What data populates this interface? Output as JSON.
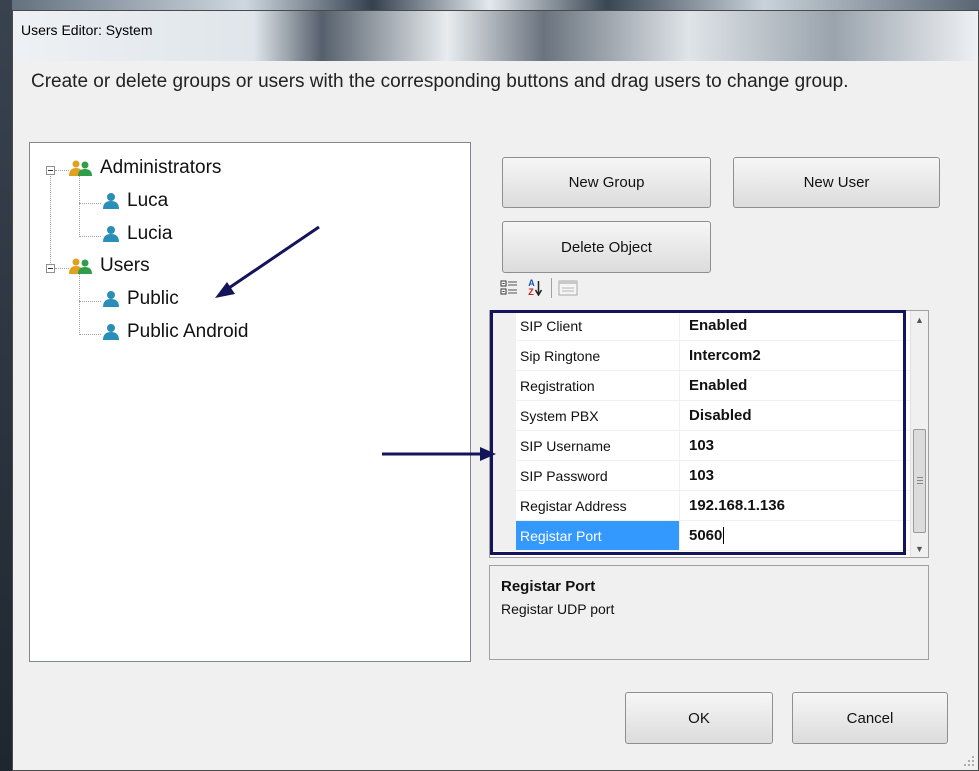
{
  "window": {
    "title": "Users Editor: System"
  },
  "instruction": "Create or delete groups or users with the corresponding buttons and drag users to change group.",
  "tree": {
    "groups": [
      {
        "label": "Administrators",
        "icon": "group-icon",
        "users": [
          "Luca",
          "Lucia"
        ]
      },
      {
        "label": "Users",
        "icon": "group-icon",
        "users": [
          "Public",
          "Public Android"
        ]
      }
    ]
  },
  "buttons": {
    "new_group": "New Group",
    "new_user": "New User",
    "delete_object": "Delete Object",
    "ok": "OK",
    "cancel": "Cancel"
  },
  "toolbar": {
    "icons": [
      "categorized-icon",
      "alphabetical-sort-icon",
      "property-pages-icon"
    ],
    "sort_glyph_top": "A",
    "sort_glyph_bottom": "Z"
  },
  "properties": [
    {
      "name": "SIP Client",
      "value": "Enabled"
    },
    {
      "name": "Sip Ringtone",
      "value": "Intercom2"
    },
    {
      "name": "Registration",
      "value": "Enabled"
    },
    {
      "name": "System PBX",
      "value": "Disabled"
    },
    {
      "name": "SIP Username",
      "value": "103"
    },
    {
      "name": "SIP Password",
      "value": "103"
    },
    {
      "name": "Registar Address",
      "value": "192.168.1.136"
    },
    {
      "name": "Registar Port",
      "value": "5060"
    }
  ],
  "description": {
    "title": "Registar Port",
    "text": "Registar UDP port"
  },
  "colors": {
    "selection": "#3399ff",
    "annotation": "#14145a"
  }
}
